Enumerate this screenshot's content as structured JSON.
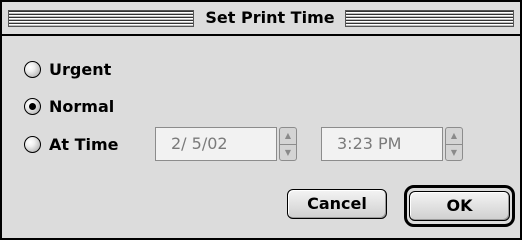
{
  "window": {
    "title": "Set Print Time"
  },
  "options": {
    "urgent_label": "Urgent",
    "normal_label": "Normal",
    "at_time_label": "At Time",
    "selected": "Normal"
  },
  "date_field": {
    "value": "2/ 5/02"
  },
  "time_field": {
    "value": "3:23 PM"
  },
  "buttons": {
    "cancel_label": "Cancel",
    "ok_label": "OK"
  },
  "icons": {
    "radio": "radio-button",
    "stepper": "up-down-arrows"
  }
}
